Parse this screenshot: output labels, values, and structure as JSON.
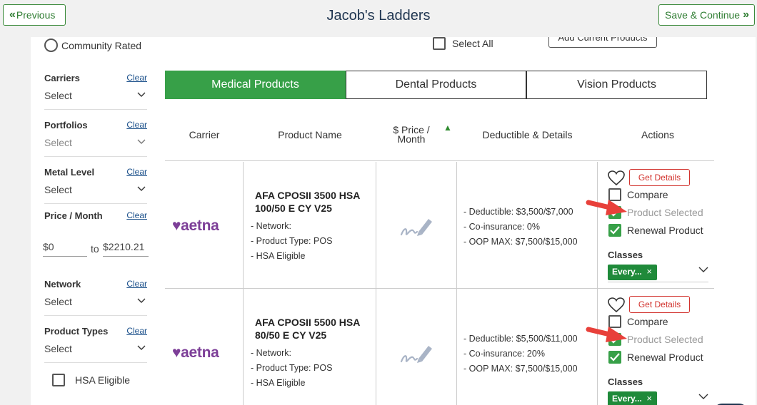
{
  "header": {
    "previous_label": "Previous",
    "title": "Jacob's Ladders",
    "next_label": "Save & Continue"
  },
  "sidebar": {
    "community_rated": "Community Rated",
    "clear_label": "Clear",
    "filters": [
      {
        "label": "Carriers",
        "value": "Select"
      },
      {
        "label": "Portfolios",
        "value": "Select"
      },
      {
        "label": "Metal Level",
        "value": "Select"
      },
      {
        "label": "Price / Month"
      },
      {
        "label": "Network",
        "value": "Select"
      },
      {
        "label": "Product Types",
        "value": "Select"
      }
    ],
    "price_min": "$0",
    "price_to": "to",
    "price_max": "$2210.21",
    "hsa_eligible": "HSA Eligible"
  },
  "top": {
    "select_all": "Select All",
    "add_current": "Add Current Products"
  },
  "tabs": [
    "Medical Products",
    "Dental Products",
    "Vision Products"
  ],
  "columns": {
    "carrier": "Carrier",
    "product_name": "Product Name",
    "price": "$ Price / Month",
    "details": "Deductible & Details",
    "actions": "Actions"
  },
  "actions_labels": {
    "get_details": "Get Details",
    "compare": "Compare",
    "product_selected": "Product Selected",
    "renewal_product": "Renewal Product",
    "classes": "Classes",
    "class_tag": "Every..."
  },
  "rows": [
    {
      "carrier": "aetna",
      "name": "AFA CPOSII 3500 HSA 100/50 E CY V25",
      "network": "- Network:",
      "type": "- Product Type: POS",
      "hsa": "- HSA Eligible",
      "deductible": "- Deductible: $3,500/$7,000",
      "coins": "- Co-insurance: 0%",
      "oop": "- OOP MAX: $7,500/$15,000"
    },
    {
      "carrier": "aetna",
      "name": "AFA CPOSII 5500 HSA 80/50 E CY V25",
      "network": "- Network:",
      "type": "- Product Type: POS",
      "hsa": "- HSA Eligible",
      "deductible": "- Deductible: $5,500/$11,000",
      "coins": "- Co-insurance: 20%",
      "oop": "- OOP MAX: $7,500/$15,000"
    }
  ],
  "colors": {
    "accent_green": "#37a048",
    "aetna_purple": "#7d3f98",
    "danger_red": "#d2322d"
  }
}
